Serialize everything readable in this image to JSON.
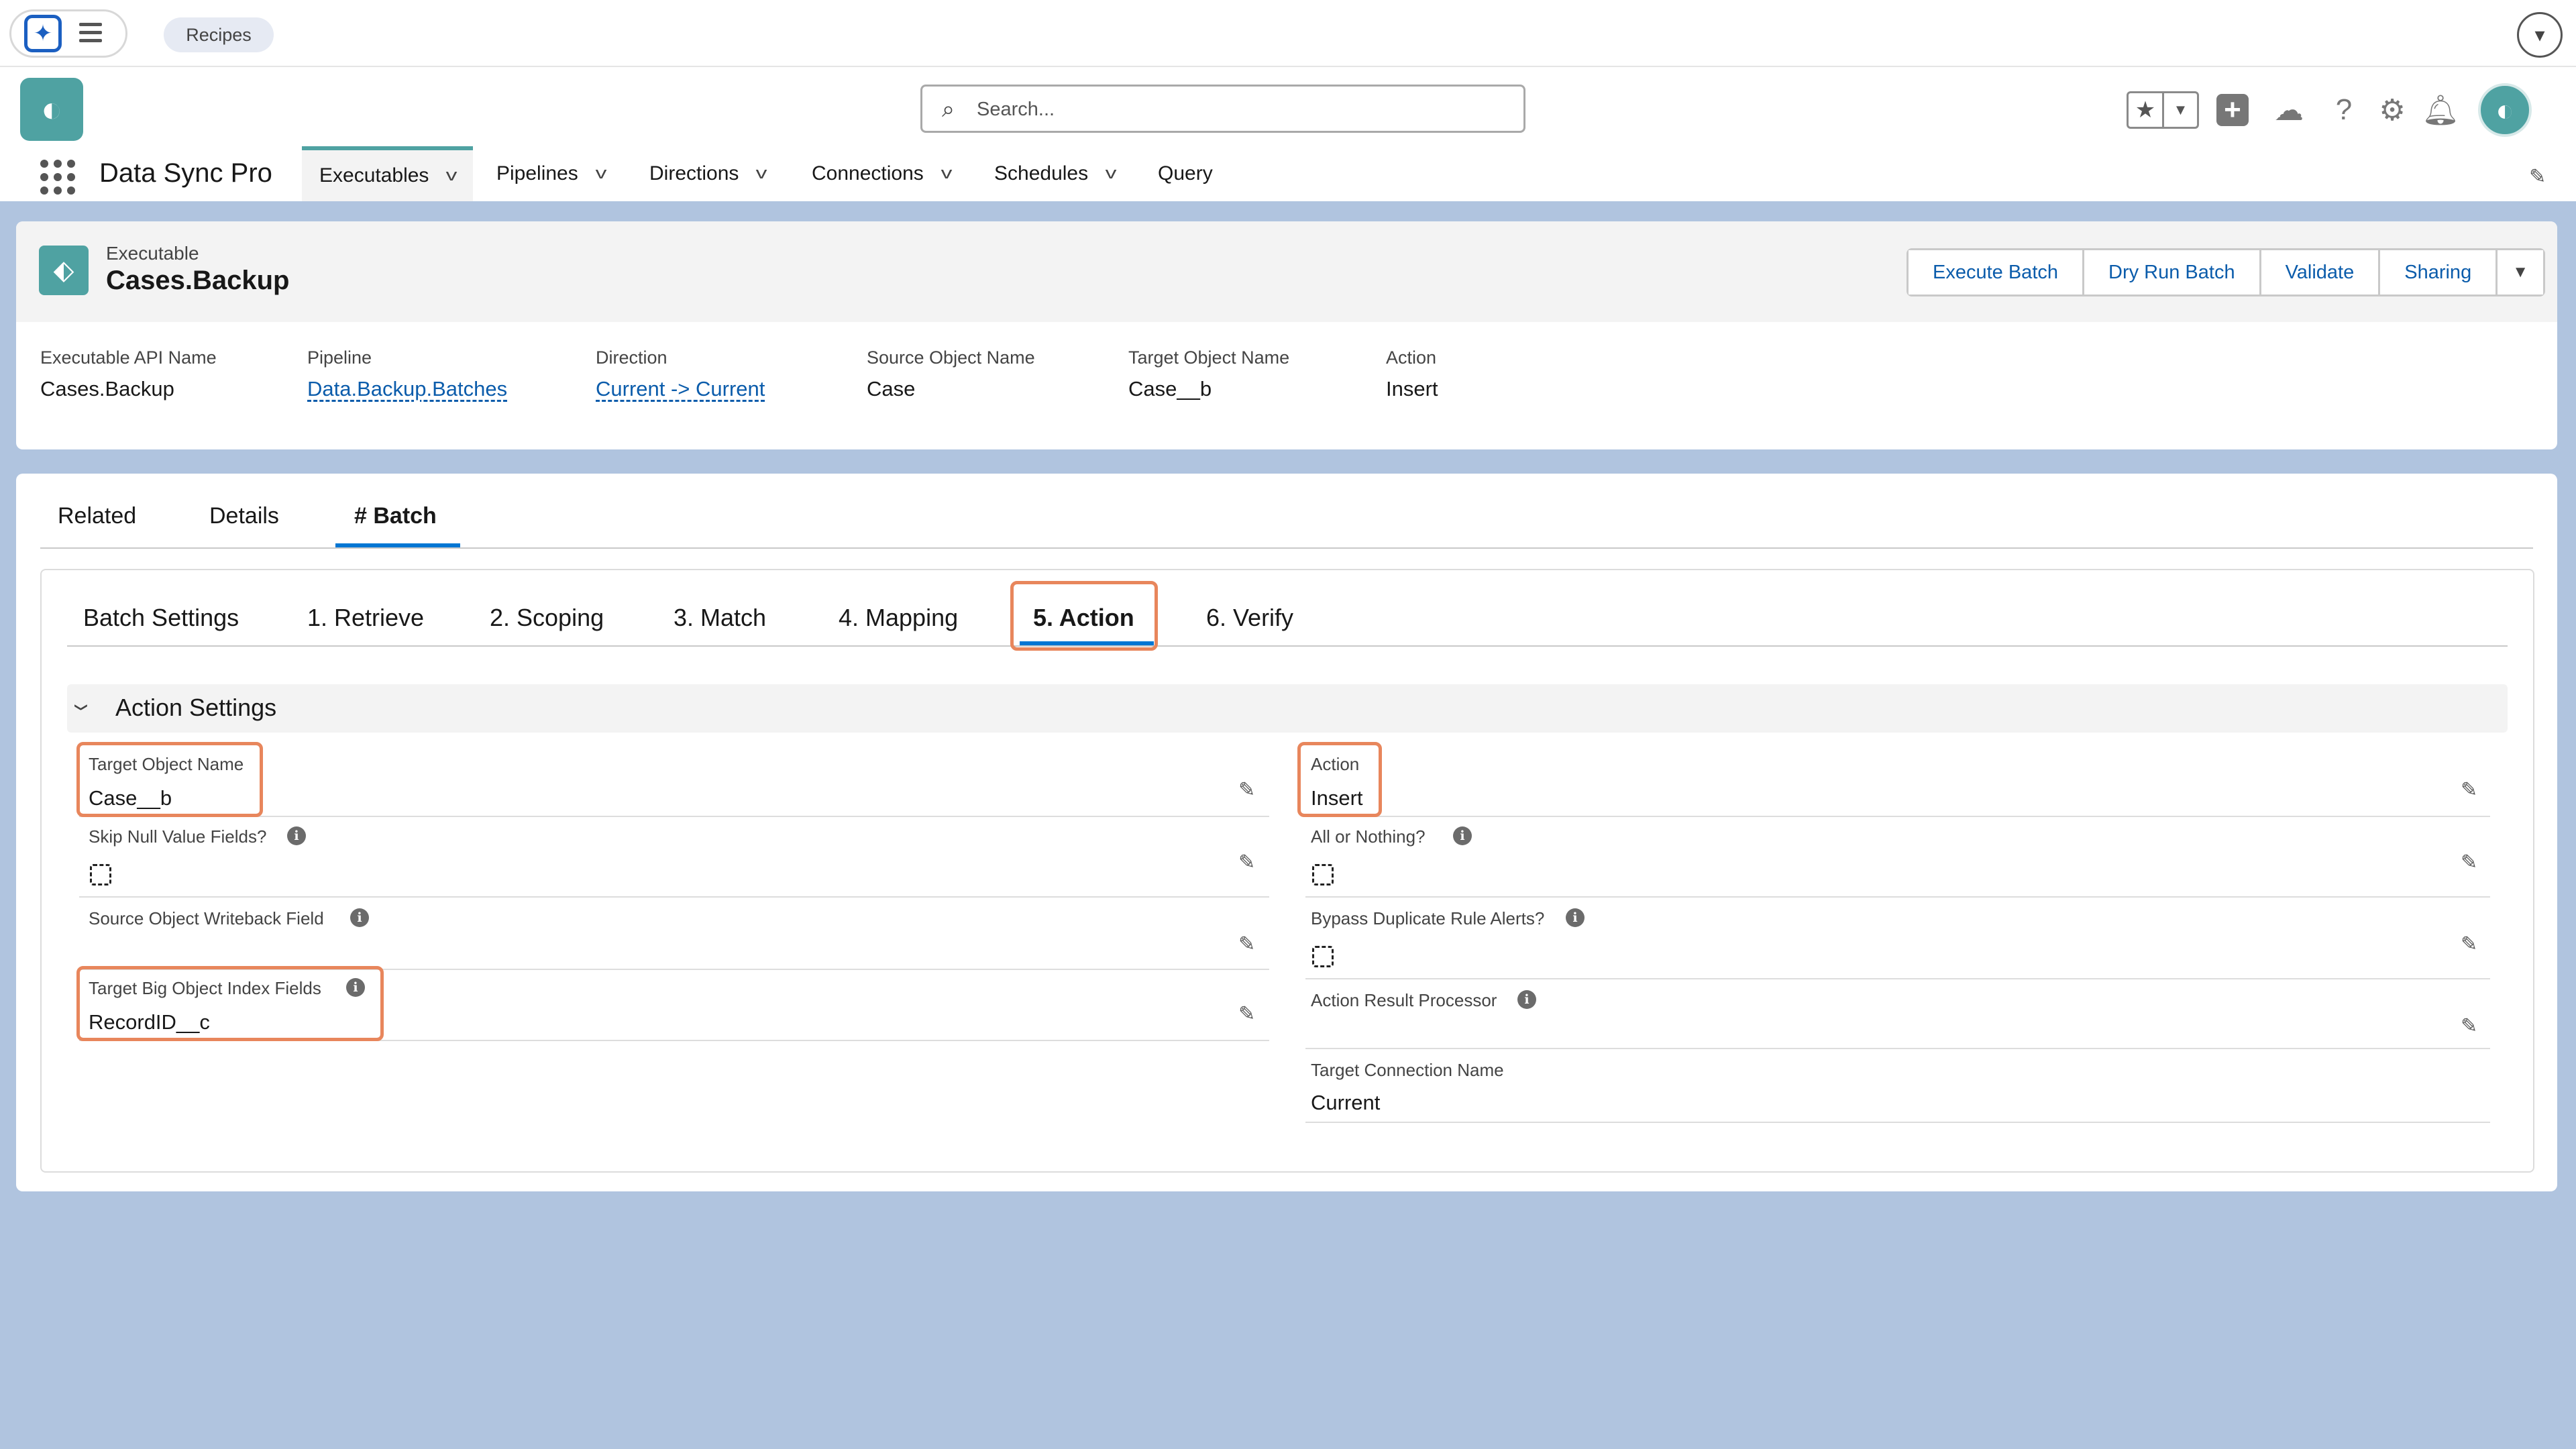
{
  "utility_bar": {
    "recipes_label": "Recipes"
  },
  "header": {
    "search_placeholder": "Search...",
    "app_name": "Data Sync Pro"
  },
  "nav": {
    "items": [
      {
        "label": "Executables",
        "has_menu": true,
        "active": true
      },
      {
        "label": "Pipelines",
        "has_menu": true
      },
      {
        "label": "Directions",
        "has_menu": true
      },
      {
        "label": "Connections",
        "has_menu": true
      },
      {
        "label": "Schedules",
        "has_menu": true
      },
      {
        "label": "Query",
        "has_menu": false
      }
    ]
  },
  "record": {
    "type_label": "Executable",
    "name": "Cases.Backup",
    "buttons": [
      "Execute Batch",
      "Dry Run Batch",
      "Validate",
      "Sharing"
    ],
    "highlights": [
      {
        "label": "Executable API Name",
        "value": "Cases.Backup",
        "link": false
      },
      {
        "label": "Pipeline",
        "value": "Data.Backup.Batches",
        "link": true
      },
      {
        "label": "Direction",
        "value": "Current -> Current",
        "link": true
      },
      {
        "label": "Source Object Name",
        "value": "Case",
        "link": false
      },
      {
        "label": "Target Object Name",
        "value": "Case__b",
        "link": false
      },
      {
        "label": "Action",
        "value": "Insert",
        "link": false
      }
    ]
  },
  "tabs": [
    "Related",
    "Details",
    "# Batch"
  ],
  "active_tab": "# Batch",
  "batch_tabs": [
    "Batch Settings",
    "1. Retrieve",
    "2. Scoping",
    "3. Match",
    "4. Mapping",
    "5. Action",
    "6. Verify"
  ],
  "active_batch_tab": "5. Action",
  "section": {
    "title": "Action Settings",
    "left_fields": [
      {
        "label": "Target Object Name",
        "value": "Case__b"
      },
      {
        "label": "Skip Null Value Fields?",
        "checkbox": false
      },
      {
        "label": "Source Object Writeback Field",
        "value": ""
      },
      {
        "label": "Target Big Object Index Fields",
        "value": "RecordID__c"
      }
    ],
    "right_fields": [
      {
        "label": "Action",
        "value": "Insert"
      },
      {
        "label": "All or Nothing?",
        "checkbox": false
      },
      {
        "label": "Bypass Duplicate Rule Alerts?",
        "checkbox": false
      },
      {
        "label": "Action Result Processor",
        "value": ""
      },
      {
        "label": "Target Connection Name",
        "value": "Current"
      }
    ]
  },
  "colors": {
    "brand_teal": "#4fa2a2",
    "link_blue": "#0b5cab",
    "highlight_orange": "#e8865c",
    "page_background": "#b0c4df"
  }
}
